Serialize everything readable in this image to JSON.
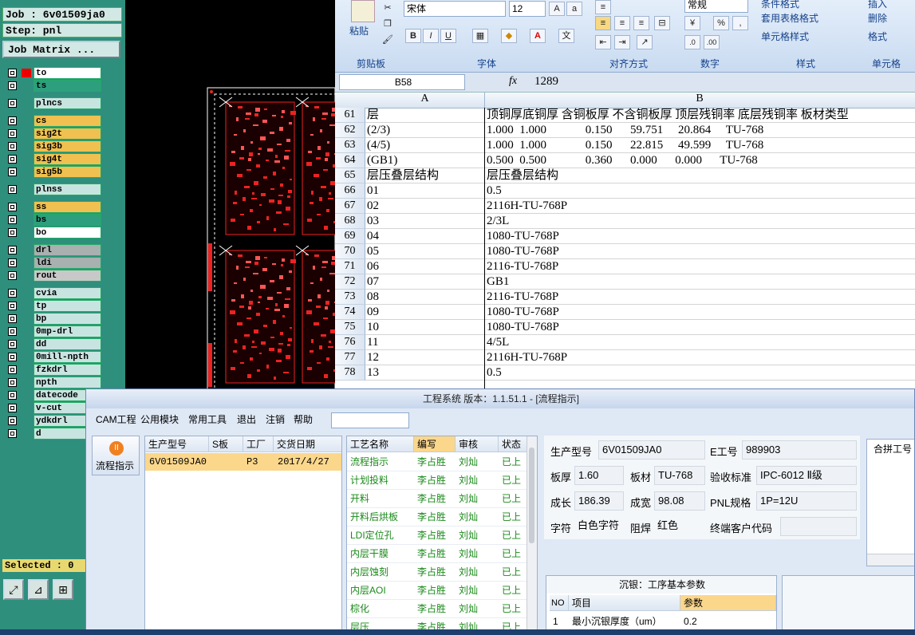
{
  "cam": {
    "job": "Job : 6v01509ja0",
    "step": "Step: pnl",
    "matrix_button": "Job Matrix ...",
    "selected": "Selected : 0",
    "layers": [
      {
        "name": "to",
        "color": "white"
      },
      {
        "name": "ts",
        "color": "green"
      },
      {
        "name": "plncs",
        "color": "teal"
      },
      {
        "name": "cs",
        "color": "yellow"
      },
      {
        "name": "sig2t",
        "color": "yellow"
      },
      {
        "name": "sig3b",
        "color": "yellow"
      },
      {
        "name": "sig4t",
        "color": "yellow"
      },
      {
        "name": "sig5b",
        "color": "yellow"
      },
      {
        "name": "plnss",
        "color": "teal"
      },
      {
        "name": "ss",
        "color": "yellow"
      },
      {
        "name": "bs",
        "color": "green"
      },
      {
        "name": "bo",
        "color": "white"
      },
      {
        "name": "drl",
        "color": "gray"
      },
      {
        "name": "ldi",
        "color": "gray"
      },
      {
        "name": "rout",
        "color": "lgray"
      },
      {
        "name": "cvia",
        "color": "teal"
      },
      {
        "name": "tp",
        "color": "teal"
      },
      {
        "name": "bp",
        "color": "teal"
      },
      {
        "name": "0mp-drl",
        "color": "teal"
      },
      {
        "name": "dd",
        "color": "teal"
      },
      {
        "name": "0mill-npth",
        "color": "teal"
      },
      {
        "name": "fzkdrl",
        "color": "teal"
      },
      {
        "name": "npth",
        "color": "teal"
      },
      {
        "name": "datecode",
        "color": "teal"
      },
      {
        "name": "v-cut",
        "color": "teal"
      },
      {
        "name": "ydkdrl",
        "color": "teal"
      },
      {
        "name": "d",
        "color": "teal"
      }
    ]
  },
  "ribbon": {
    "paste": "粘贴",
    "font_name": "宋体",
    "font_size": "12",
    "number_format": "常规",
    "cond_format": "条件格式",
    "table_format": "套用表格格式",
    "cell_style": "单元格样式",
    "insert": "插入",
    "delete": "删除",
    "format": "格式",
    "groups": {
      "clipboard": "剪贴板",
      "font": "字体",
      "align": "对齐方式",
      "number": "数字",
      "style": "样式",
      "cells": "单元格"
    }
  },
  "formula": {
    "name_box": "B58",
    "fx": "fx",
    "value": "1289"
  },
  "sheet": {
    "col_a": "A",
    "col_b": "B",
    "rows": [
      {
        "n": "61",
        "a": "层",
        "b": "顶铜厚底铜厚 含铜板厚 不含铜板厚 顶层残铜率 底层残铜率 板材类型"
      },
      {
        "n": "62",
        "a": "(2/3)",
        "b": "1.000  1.000             0.150      59.751     20.864     TU-768"
      },
      {
        "n": "63",
        "a": "(4/5)",
        "b": "1.000  1.000             0.150      22.815     49.599     TU-768"
      },
      {
        "n": "64",
        "a": "(GB1)",
        "b": "0.500  0.500             0.360      0.000      0.000      TU-768"
      },
      {
        "n": "65",
        "a": "层压叠层结构",
        "b": "层压叠层结构"
      },
      {
        "n": "66",
        "a": "01",
        "b": "0.5"
      },
      {
        "n": "67",
        "a": "02",
        "b": "2116H-TU-768P"
      },
      {
        "n": "68",
        "a": "03",
        "b": "2/3L"
      },
      {
        "n": "69",
        "a": "04",
        "b": "1080-TU-768P"
      },
      {
        "n": "70",
        "a": "05",
        "b": "1080-TU-768P"
      },
      {
        "n": "71",
        "a": "06",
        "b": "2116-TU-768P"
      },
      {
        "n": "72",
        "a": "07",
        "b": "GB1"
      },
      {
        "n": "73",
        "a": "08",
        "b": "2116-TU-768P"
      },
      {
        "n": "74",
        "a": "09",
        "b": "1080-TU-768P"
      },
      {
        "n": "75",
        "a": "10",
        "b": "1080-TU-768P"
      },
      {
        "n": "76",
        "a": "11",
        "b": "4/5L"
      },
      {
        "n": "77",
        "a": "12",
        "b": "2116H-TU-768P"
      },
      {
        "n": "78",
        "a": "13",
        "b": "0.5"
      }
    ]
  },
  "app": {
    "title": "工程系统  版本：1.1.51.1 - [流程指示]",
    "menu": [
      "CAM工程",
      "公用模块",
      "常用工具",
      "退出",
      "注销",
      "帮助"
    ],
    "flow_button": "流程指示",
    "order_headers": [
      "生产型号",
      "S板",
      "工厂",
      "交货日期"
    ],
    "order_row": {
      "model": "6V01509JA0",
      "s": "",
      "factory": "P3",
      "date": "2017/4/27"
    },
    "proc_headers": [
      "工艺名称",
      "编写",
      "审核",
      "状态"
    ],
    "processes": [
      {
        "name": "流程指示",
        "author": "李占胜",
        "reviewer": "刘灿",
        "status": "已上"
      },
      {
        "name": "计划投料",
        "author": "李占胜",
        "reviewer": "刘灿",
        "status": "已上"
      },
      {
        "name": "开料",
        "author": "李占胜",
        "reviewer": "刘灿",
        "status": "已上"
      },
      {
        "name": "开料后烘板",
        "author": "李占胜",
        "reviewer": "刘灿",
        "status": "已上"
      },
      {
        "name": "LDI定位孔",
        "author": "李占胜",
        "reviewer": "刘灿",
        "status": "已上"
      },
      {
        "name": "内层干膜",
        "author": "李占胜",
        "reviewer": "刘灿",
        "status": "已上"
      },
      {
        "name": "内层蚀刻",
        "author": "李占胜",
        "reviewer": "刘灿",
        "status": "已上"
      },
      {
        "name": "内层AOI",
        "author": "李占胜",
        "reviewer": "刘灿",
        "status": "已上"
      },
      {
        "name": "棕化",
        "author": "李占胜",
        "reviewer": "刘灿",
        "status": "已上"
      },
      {
        "name": "层压",
        "author": "李占胜",
        "reviewer": "刘灿",
        "status": "已上"
      }
    ],
    "detail": {
      "model_label": "生产型号",
      "model": "6V01509JA0",
      "eno_label": "E工号",
      "eno": "989903",
      "thick_label": "板厚",
      "thick": "1.60",
      "mat_label": "板材",
      "mat": "TU-768",
      "std_label": "验收标准",
      "std": "IPC-6012 Ⅱ级",
      "len_label": "成长",
      "len": "186.39",
      "wid_label": "成宽",
      "wid": "98.08",
      "pnl_label": "PNL规格",
      "pnl": "1P=12U",
      "char_label": "字符",
      "char": "白色字符",
      "mask_label": "阻焊",
      "mask": "红色",
      "cust_label": "终端客户代码",
      "cust": ""
    },
    "merge_label": "合拼工号",
    "sub_title": "沉银：工序基本参数",
    "sub_headers": [
      "NO",
      "项目",
      "参数"
    ],
    "sub_row": {
      "no": "1",
      "item": "最小沉银厚度（um）",
      "val": "0.2"
    }
  }
}
